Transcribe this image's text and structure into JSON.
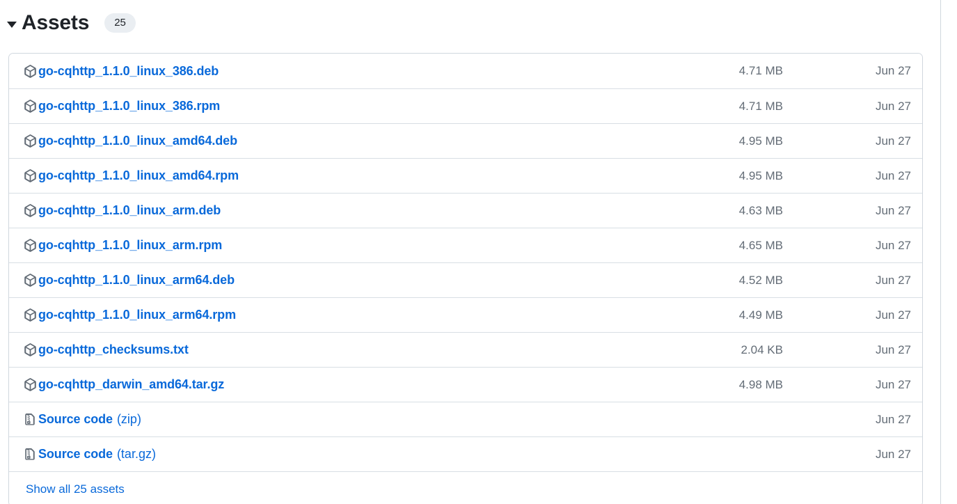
{
  "assets_section": {
    "title": "Assets",
    "count_badge": "25",
    "expanded": true,
    "disclosure_icon": "triangle-down-icon",
    "colors": {
      "link": "#0969da",
      "muted_text": "#636c76",
      "heading": "#1f2328",
      "border": "#d0d7de",
      "row_divider": "#d8dee4",
      "badge_bg": "#eaeef2"
    },
    "rows": [
      {
        "icon": "package-icon",
        "name": "go-cqhttp_1.1.0_linux_386.deb",
        "suffix": "",
        "size": "4.71 MB",
        "date": "Jun 27"
      },
      {
        "icon": "package-icon",
        "name": "go-cqhttp_1.1.0_linux_386.rpm",
        "suffix": "",
        "size": "4.71 MB",
        "date": "Jun 27"
      },
      {
        "icon": "package-icon",
        "name": "go-cqhttp_1.1.0_linux_amd64.deb",
        "suffix": "",
        "size": "4.95 MB",
        "date": "Jun 27"
      },
      {
        "icon": "package-icon",
        "name": "go-cqhttp_1.1.0_linux_amd64.rpm",
        "suffix": "",
        "size": "4.95 MB",
        "date": "Jun 27"
      },
      {
        "icon": "package-icon",
        "name": "go-cqhttp_1.1.0_linux_arm.deb",
        "suffix": "",
        "size": "4.63 MB",
        "date": "Jun 27"
      },
      {
        "icon": "package-icon",
        "name": "go-cqhttp_1.1.0_linux_arm.rpm",
        "suffix": "",
        "size": "4.65 MB",
        "date": "Jun 27"
      },
      {
        "icon": "package-icon",
        "name": "go-cqhttp_1.1.0_linux_arm64.deb",
        "suffix": "",
        "size": "4.52 MB",
        "date": "Jun 27"
      },
      {
        "icon": "package-icon",
        "name": "go-cqhttp_1.1.0_linux_arm64.rpm",
        "suffix": "",
        "size": "4.49 MB",
        "date": "Jun 27"
      },
      {
        "icon": "package-icon",
        "name": "go-cqhttp_checksums.txt",
        "suffix": "",
        "size": "2.04 KB",
        "date": "Jun 27"
      },
      {
        "icon": "package-icon",
        "name": "go-cqhttp_darwin_amd64.tar.gz",
        "suffix": "",
        "size": "4.98 MB",
        "date": "Jun 27"
      },
      {
        "icon": "file-zip-icon",
        "name": "Source code",
        "suffix": "(zip)",
        "size": "",
        "date": "Jun 27"
      },
      {
        "icon": "file-zip-icon",
        "name": "Source code",
        "suffix": "(tar.gz)",
        "size": "",
        "date": "Jun 27"
      }
    ],
    "show_all_label": "Show all 25 assets"
  }
}
